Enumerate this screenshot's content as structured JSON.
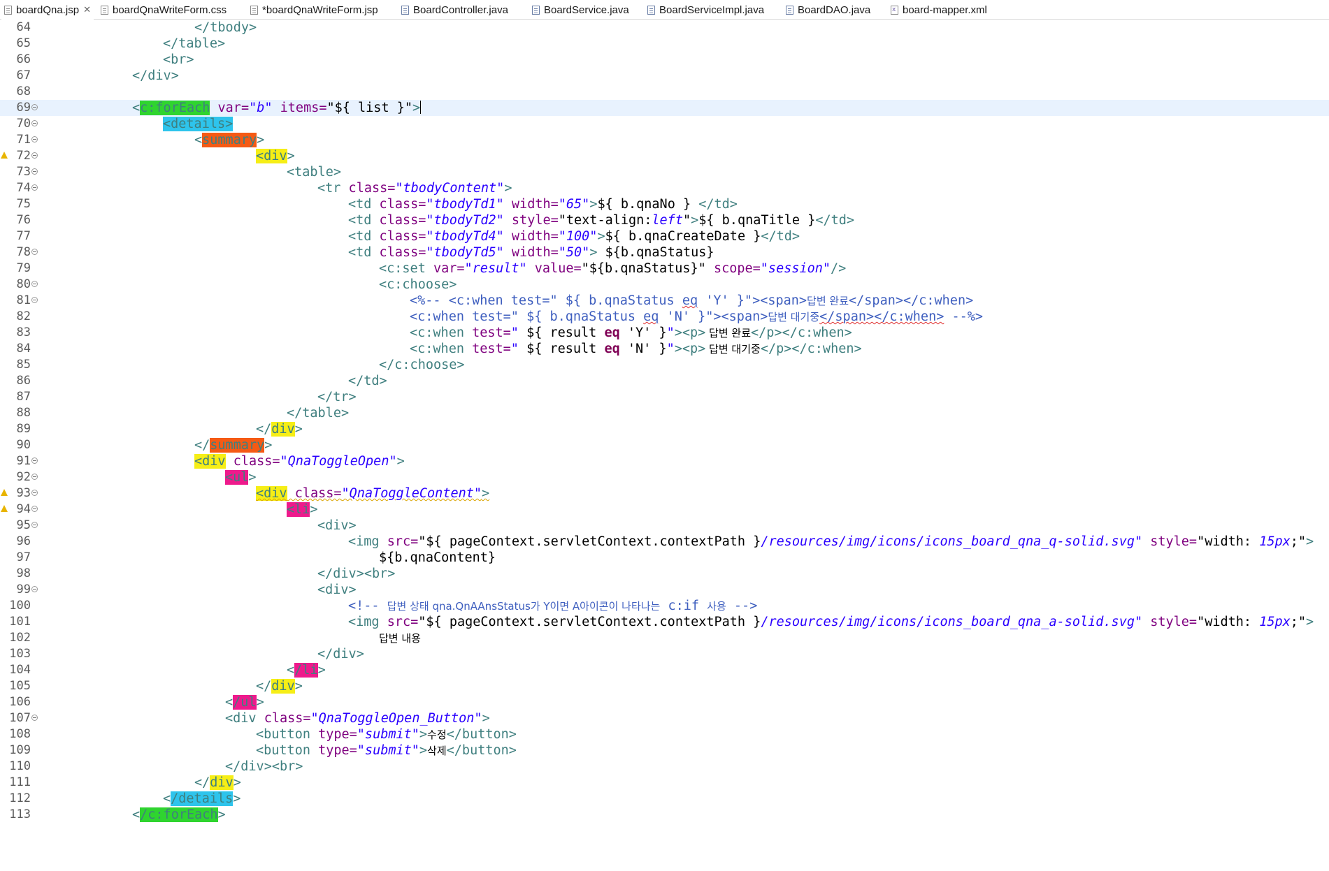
{
  "tabs": [
    {
      "label": "boardQna.jsp",
      "icon": "jsp-file-icon",
      "active": true,
      "close": "✕"
    },
    {
      "label": "boardQnaWriteForm.css",
      "icon": "css-file-icon"
    },
    {
      "label": "*boardQnaWriteForm.jsp",
      "icon": "jsp-file-icon"
    },
    {
      "label": "BoardController.java",
      "icon": "java-file-icon"
    },
    {
      "label": "BoardService.java",
      "icon": "java-file-icon"
    },
    {
      "label": "BoardServiceImpl.java",
      "icon": "java-file-icon"
    },
    {
      "label": "BoardDAO.java",
      "icon": "java-file-icon"
    },
    {
      "label": "board-mapper.xml",
      "icon": "xml-file-icon"
    }
  ],
  "editor": {
    "current_line": "69",
    "line_numbers": [
      "64",
      "65",
      "66",
      "67",
      "68",
      "69",
      "70",
      "71",
      "72",
      "73",
      "74",
      "75",
      "76",
      "77",
      "78",
      "79",
      "80",
      "81",
      "82",
      "83",
      "84",
      "85",
      "86",
      "87",
      "88",
      "89",
      "90",
      "91",
      "92",
      "93",
      "94",
      "95",
      "96",
      "97",
      "98",
      "99",
      "100",
      "101",
      "102",
      "103",
      "104",
      "105",
      "106",
      "107",
      "108",
      "109",
      "110",
      "111",
      "112",
      "113"
    ],
    "text": {
      "l64": "</tbody>",
      "l65": "</table>",
      "l66": "<br>",
      "l67": "</div>",
      "l69_open": "<",
      "l69_tag": "c:forEach",
      "l69_a1": " var=",
      "l69_v1": "\"b\"",
      "l69_a2": " items=",
      "l69_v2": "\"${ list }\"",
      "l69_close": ">",
      "l70_tag": "<details>",
      "l71_open": "<",
      "l71_tag": "summary",
      "l71_close": ">",
      "l72_tag": "<div",
      "l72_close": ">",
      "l73": "<table>",
      "l74_tag": "<tr",
      "l74_a": " class=",
      "l74_v": "\"tbodyContent\"",
      "l74_c": ">",
      "l75_tag": "<td",
      "l75_a1": " class=",
      "l75_v1": "\"tbodyTd1\"",
      "l75_a2": " width=",
      "l75_v2": "\"65\"",
      "l75_c": ">",
      "l75_el": "${ b.qnaNo } ",
      "l75_end": "</td>",
      "l76_tag": "<td",
      "l76_a1": " class=",
      "l76_v1": "\"tbodyTd2\"",
      "l76_a2": " style=",
      "l76_v2a": "\"text-align:",
      "l76_v2b": "left",
      "l76_v2c": "\"",
      "l76_c": ">",
      "l76_el": "${ b.qnaTitle }",
      "l76_end": "</td>",
      "l77_tag": "<td",
      "l77_a1": " class=",
      "l77_v1": "\"tbodyTd4\"",
      "l77_a2": " width=",
      "l77_v2": "\"100\"",
      "l77_c": ">",
      "l77_el": "${ b.qnaCreateDate }",
      "l77_end": "</td>",
      "l78_tag": "<td",
      "l78_a1": " class=",
      "l78_v1": "\"tbodyTd5\"",
      "l78_a2": " width=",
      "l78_v2": "\"50\"",
      "l78_c": ">",
      "l78_el": " ${b.qnaStatus}",
      "l79_tag": "<c:set",
      "l79_a1": " var=",
      "l79_v1": "\"result\"",
      "l79_a2": " value=",
      "l79_v2": "\"${b.qnaStatus}\"",
      "l79_a3": " scope=",
      "l79_v3": "\"session\"",
      "l79_c": "/>",
      "l80": "<c:choose>",
      "l81_a": "<%-- <c:when test=\" ${ b.qnaStatus ",
      "l81_b": "eq",
      "l81_c": " 'Y' }\"><span>",
      "l81_kr": "답변 완료",
      "l81_d": "</span></c:when>",
      "l82_a": "<c:when test=\" ${ b.qnaStatus ",
      "l82_b": "eq",
      "l82_c": " 'N' }\"><span>",
      "l82_kr": "답변 대기중",
      "l82_d": "</span></c:when>",
      "l82_e": " --%>",
      "l83_tag": "<c:when",
      "l83_a": " test=",
      "l83_v1": "\" ",
      "l83_el1": "${ result ",
      "l83_kw": "eq",
      "l83_el2": " 'Y' }",
      "l83_v2": "\"",
      "l83_c": "><p>",
      "l83_kr": " 답변 완료",
      "l83_end": "</p></c:when>",
      "l84_tag": "<c:when",
      "l84_a": " test=",
      "l84_v1": "\" ",
      "l84_el1": "${ result ",
      "l84_kw": "eq",
      "l84_el2": " 'N' }",
      "l84_v2": "\"",
      "l84_c": "><p>",
      "l84_kr": " 답변 대기중",
      "l84_end": "</p></c:when>",
      "l85": "</c:choose>",
      "l86": "</td>",
      "l87": "</tr>",
      "l88": "</table>",
      "l89_open": "</",
      "l89_tag": "div",
      "l89_close": ">",
      "l90_open": "</",
      "l90_tag": "summary",
      "l90_close": ">",
      "l91_tag": "<div",
      "l91_a": " class=",
      "l91_v": "\"QnaToggleOpen\"",
      "l91_c": ">",
      "l92_tag": "<ul",
      "l92_c": ">",
      "l93_tag": "<div",
      "l93_a": " class=",
      "l93_v": "\"QnaToggleContent\"",
      "l93_c": ">",
      "l94_tag": "<li",
      "l94_c": ">",
      "l95": "<div>",
      "l96_tag": "<img",
      "l96_a1": " src=",
      "l96_v1": "\"",
      "l96_el": "${ pageContext.servletContext.contextPath }",
      "l96_v2": "/resources/img/icons/icons_board_qna_q-solid.svg\"",
      "l96_a2": " style=",
      "l96_v3a": "\"width: ",
      "l96_v3b": "15px",
      "l96_v3c": ";\"",
      "l96_c": ">",
      "l97": "${b.qnaContent}",
      "l98": "</div><br>",
      "l99": "<div>",
      "l100_a": "<!-- ",
      "l100_kr1": "답변 상태",
      "l100_b": " qna.QnAAnsStatus",
      "l100_kr2": "가 Y이면 A아이콘이 나타나는",
      "l100_c": " c:if ",
      "l100_kr3": "사용",
      "l100_d": " -->",
      "l101_tag": "<img",
      "l101_a1": " src=",
      "l101_v1": "\"",
      "l101_el": "${ pageContext.servletContext.contextPath }",
      "l101_v2": "/resources/img/icons/icons_board_qna_a-solid.svg\"",
      "l101_a2": " style=",
      "l101_v3a": "\"width: ",
      "l101_v3b": "15px",
      "l101_v3c": ";\"",
      "l101_c": ">",
      "l102": "답변 내용",
      "l103": "</div>",
      "l104_open": "<",
      "l104_tag": "/li",
      "l104_c": ">",
      "l105_open": "</",
      "l105_tag": "div",
      "l105_c": ">",
      "l106_open": "<",
      "l106_tag": "/ul",
      "l106_c": ">",
      "l107_tag": "<div",
      "l107_a": " class=",
      "l107_v": "\"QnaToggleOpen_Button\"",
      "l107_c": ">",
      "l108_tag": "<button",
      "l108_a": " type=",
      "l108_v": "\"submit\"",
      "l108_c": ">",
      "l108_kr": "수정",
      "l108_end": "</button>",
      "l109_tag": "<button",
      "l109_a": " type=",
      "l109_v": "\"submit\"",
      "l109_c": ">",
      "l109_kr": "삭제",
      "l109_end": "</button>",
      "l110": "</div><br>",
      "l111_open": "</",
      "l111_tag": "div",
      "l111_c": ">",
      "l112_open": "<",
      "l112_tag": "/details",
      "l112_c": ">",
      "l113_open": "<",
      "l113_tag": "/c:forEach",
      "l113_c": ">"
    }
  },
  "colors": {
    "tag": "#3f7f7f",
    "attribute": "#7f007f",
    "string": "#2a00ff",
    "comment": "#3f5fbf",
    "current_line_bg": "#e8f2fe",
    "highlight_green": "#2fd42f",
    "highlight_cyan": "#2ec4ec",
    "highlight_orange": "#f55a14",
    "highlight_yellow": "#f6ee16",
    "highlight_magenta": "#ee1a8c"
  }
}
